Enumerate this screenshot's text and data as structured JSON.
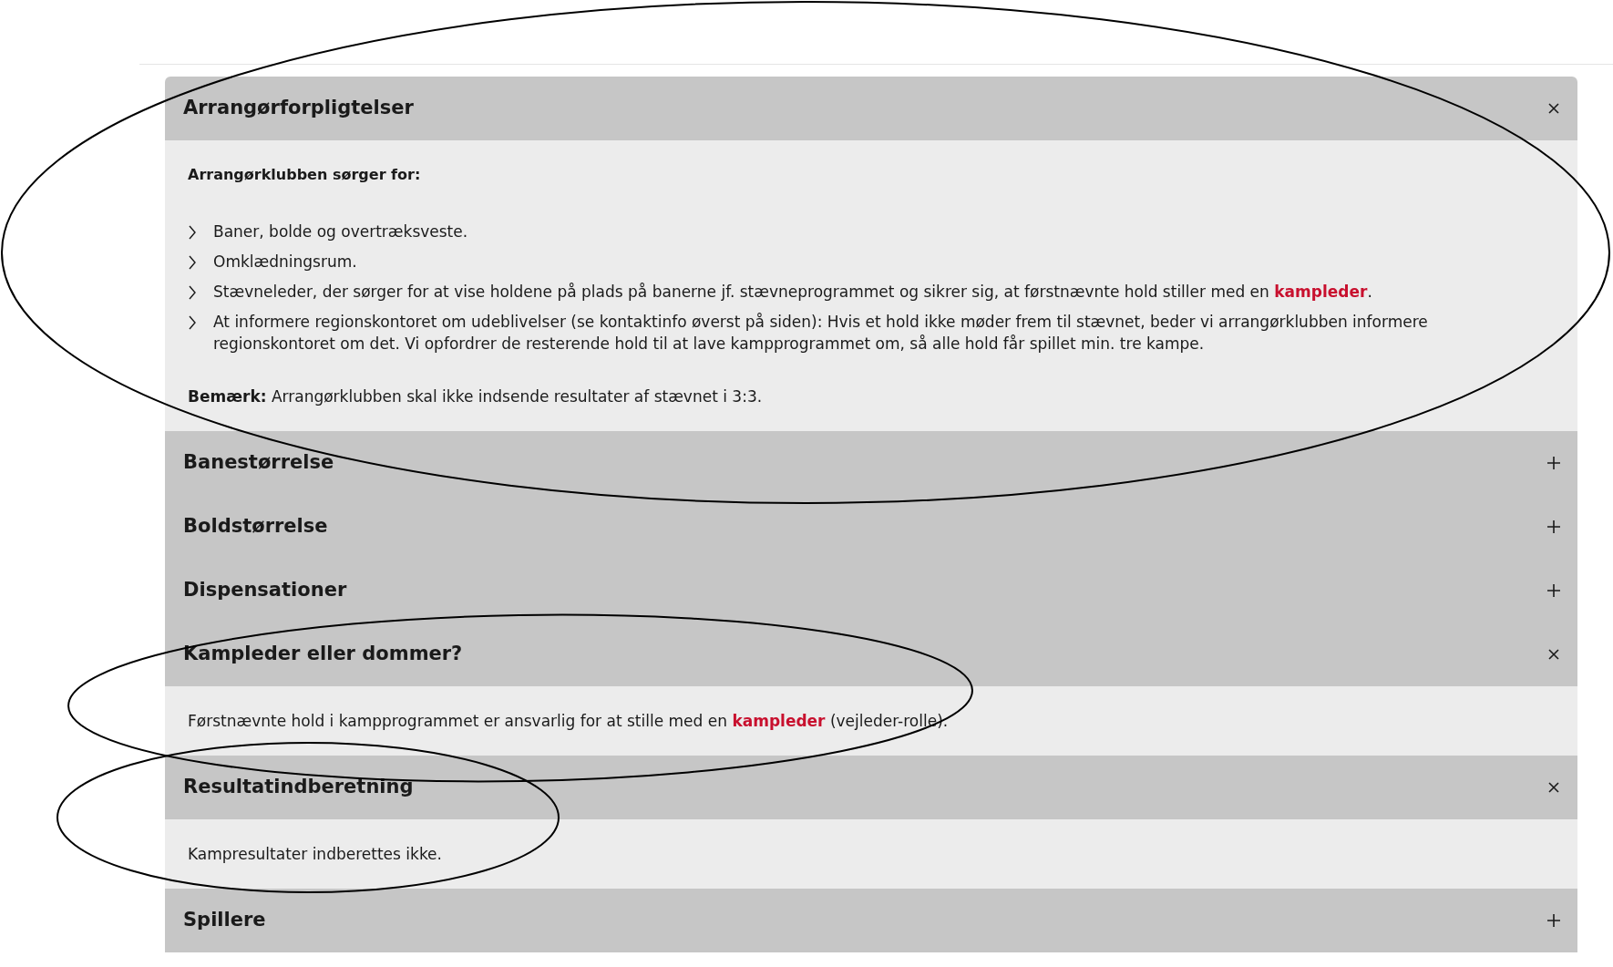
{
  "sections": [
    {
      "title": "Arrangørforpligtelser",
      "expanded": true,
      "content": [
        {
          "kind": "heading",
          "text": "Arrangørklubben sørger for:"
        },
        {
          "kind": "list",
          "items": [
            [
              {
                "kind": "text",
                "text": "Baner, bolde og overtræksveste."
              }
            ],
            [
              {
                "kind": "text",
                "text": "Omklædningsrum."
              }
            ],
            [
              {
                "kind": "text",
                "text": "Stævneleder, der sørger for at vise holdene på plads på banerne jf. stævneprogrammet og sikrer sig, at førstnævnte hold stiller med en "
              },
              {
                "kind": "link",
                "text": "kampleder"
              },
              {
                "kind": "text",
                "text": "."
              }
            ],
            [
              {
                "kind": "text",
                "text": "At informere regionskontoret om udeblivelser (se kontaktinfo øverst på siden): Hvis et hold ikke møder frem til stævnet, beder vi arrangørklubben informere regionskontoret om det. Vi opfordrer de resterende hold til at lave kampprogrammet om, så alle hold får spillet min. tre kampe."
              }
            ]
          ]
        },
        {
          "kind": "paragraph",
          "parts": [
            {
              "kind": "text",
              "text": "**Bemærk:** Arrangørklubben skal ikke indsende resultater af stævnet i 3:3."
            }
          ]
        }
      ]
    },
    {
      "title": "Banestørrelse",
      "expanded": false
    },
    {
      "title": "Boldstørrelse",
      "expanded": false
    },
    {
      "title": "Dispensationer",
      "expanded": false
    },
    {
      "title": "Kampleder eller dommer?",
      "expanded": true,
      "content": [
        {
          "kind": "paragraph",
          "parts": [
            {
              "kind": "text",
              "text": "Førstnævnte hold i kampprogrammet er ansvarlig for at stille med en "
            },
            {
              "kind": "link",
              "text": "kampleder"
            },
            {
              "kind": "text",
              "text": " (vejleder-rolle)."
            }
          ]
        }
      ]
    },
    {
      "title": "Resultatindberetning",
      "expanded": true,
      "content": [
        {
          "kind": "paragraph",
          "parts": [
            {
              "kind": "text",
              "text": "Kampresultater indberettes ikke."
            }
          ]
        }
      ]
    },
    {
      "title": "Spillere",
      "expanded": false
    }
  ]
}
